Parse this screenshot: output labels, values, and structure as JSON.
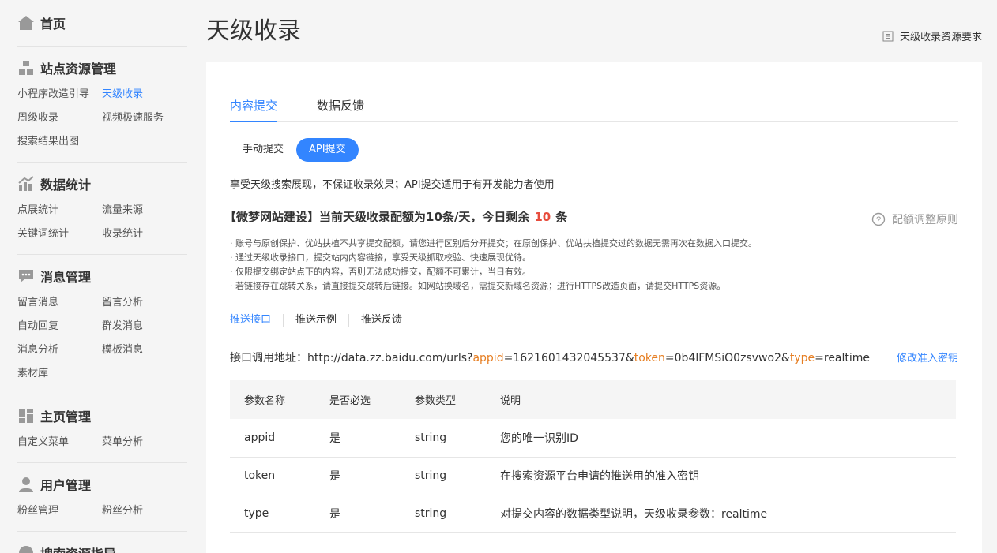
{
  "sidebar": {
    "home": "首页",
    "sections": [
      {
        "title": "站点资源管理",
        "icon": "sitemap-icon",
        "items": [
          "小程序改造引导",
          "天级收录",
          "周级收录",
          "视频极速服务",
          "搜索结果出图"
        ]
      },
      {
        "title": "数据统计",
        "icon": "chart-icon",
        "items": [
          "点展统计",
          "流量来源",
          "关键词统计",
          "收录统计"
        ]
      },
      {
        "title": "消息管理",
        "icon": "chat-icon",
        "items": [
          "留言消息",
          "留言分析",
          "自动回复",
          "群发消息",
          "消息分析",
          "模板消息",
          "素材库"
        ]
      },
      {
        "title": "主页管理",
        "icon": "layout-icon",
        "items": [
          "自定义菜单",
          "菜单分析"
        ]
      },
      {
        "title": "用户管理",
        "icon": "user-icon",
        "items": [
          "粉丝管理",
          "粉丝分析"
        ]
      },
      {
        "title": "搜索资源指导",
        "icon": "search-guide-icon",
        "items": []
      }
    ],
    "active_item": "天级收录"
  },
  "header": {
    "title": "天级收录",
    "requirements_link": "天级收录资源要求"
  },
  "tabs": [
    "内容提交",
    "数据反馈"
  ],
  "subtabs": [
    "手动提交",
    "API提交"
  ],
  "intro": "享受天级搜索展现，不保证收录效果；API提交适用于有开发能力者使用",
  "quota": {
    "prefix": "【微梦网站建设】当前天级收录配额为10条/天，今日剩余",
    "remaining": "10",
    "suffix": "条"
  },
  "rule_link": "配额调整原则",
  "notes": [
    "· 账号与原创保护、优站扶植不共享提交配额，请您进行区别后分开提交；在原创保护、优站扶植提交过的数据无需再次在数据入口提交。",
    "· 通过天级收录接口，提交站内内容链接，享受天级抓取校验、快速展现优待。",
    "· 仅限提交绑定站点下的内容，否则无法成功提交，配额不可累计，当日有效。",
    "· 若链接存在跳转关系，请直接提交跳转后链接。如网站换域名，需提交新域名资源；进行HTTPS改造页面，请提交HTTPS资源。"
  ],
  "links": [
    "推送接口",
    "推送示例",
    "推送反馈"
  ],
  "api": {
    "label": "接口调用地址：http://data.zz.baidu.com/urls?",
    "p1": "appid",
    "v1": "=1621601432045537&",
    "p2": "token",
    "v2": "=0b4lFMSiO0zsvwo2&",
    "p3": "type",
    "v3": "=realtime",
    "edit_key": "修改准入密钥"
  },
  "table": {
    "headers": [
      "参数名称",
      "是否必选",
      "参数类型",
      "说明"
    ],
    "rows": [
      [
        "appid",
        "是",
        "string",
        "您的唯一识别ID"
      ],
      [
        "token",
        "是",
        "string",
        "在搜索资源平台申请的推送用的准入密钥"
      ],
      [
        "type",
        "是",
        "string",
        "对提交内容的数据类型说明，天级收录参数：realtime"
      ]
    ]
  },
  "colors": {
    "accent": "#3385ff",
    "highlight": "#e67e22",
    "remaining": "#e74c3c"
  }
}
